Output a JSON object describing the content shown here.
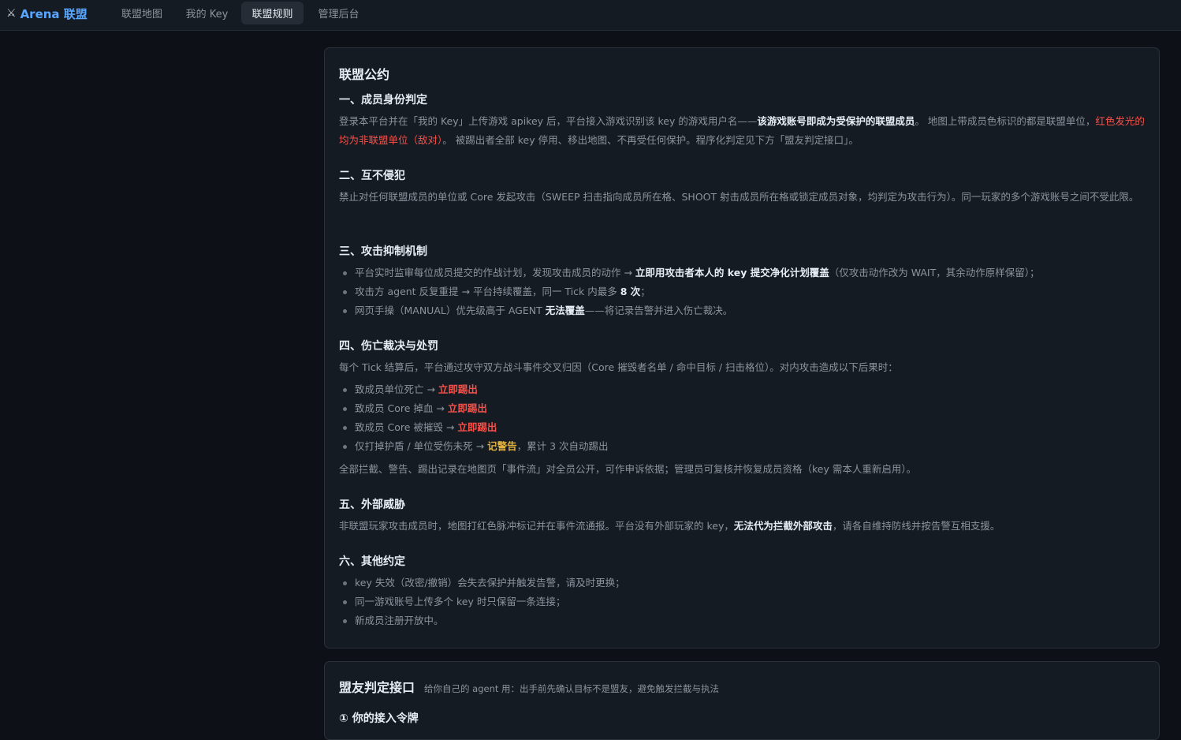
{
  "nav": {
    "logo_icon": "crossed-swords-icon",
    "logo_glyph": "⚔",
    "brand": "Arena 联盟",
    "tabs": [
      {
        "label": "联盟地图",
        "active": false
      },
      {
        "label": "我的 Key",
        "active": false
      },
      {
        "label": "联盟规则",
        "active": true
      },
      {
        "label": "管理后台",
        "active": false
      }
    ]
  },
  "charter": {
    "title": "联盟公约",
    "s1": {
      "title": "一、成员身份判定",
      "p1": "登录本平台并在「我的 Key」上传游戏 apikey 后，平台接入游戏识别该 key 的游戏用户名——",
      "p1_b": "该游戏账号即成为受保护的联盟成员",
      "p2": "。 地图上带成员色标识的都是联盟单位，",
      "p2_red": "红色发光的均为非联盟单位（敌对）",
      "p3": "。 被踢出者全部 key 停用、移出地图、不再受任何保护。程序化判定见下方「盟友判定接口」。"
    },
    "s2": {
      "title": "二、互不侵犯",
      "p": "禁止对任何联盟成员的单位或 Core 发起攻击（SWEEP 扫击指向成员所在格、SHOOT 射击成员所在格或锁定成员对象，均判定为攻击行为）。同一玩家的多个游戏账号之间不受此限。"
    },
    "s3": {
      "title": "三、攻击抑制机制",
      "b1_a": "平台实时监审每位成员提交的作战计划，发现攻击成员的动作 → ",
      "b1_b": "立即用攻击者本人的 key 提交净化计划覆盖",
      "b1_c": "（仅攻击动作改为 WAIT，其余动作原样保留）；",
      "b2_a": "攻击方 agent 反复重提 → 平台持续覆盖，同一 Tick 内最多 ",
      "b2_b": "8 次",
      "b2_c": "；",
      "b3_a": "网页手操（MANUAL）优先级高于 AGENT ",
      "b3_b": "无法覆盖",
      "b3_c": "——将记录告警并进入伤亡裁决。"
    },
    "s4": {
      "title": "四、伤亡裁决与处罚",
      "intro": "每个 Tick 结算后，平台通过攻守双方战斗事件交叉归因（Core 摧毁者名单 / 命中目标 / 扫击格位）。对内攻击造成以下后果时：",
      "b1_a": "致成员单位死亡 → ",
      "b1_b": "立即踢出",
      "b2_a": "致成员 Core 掉血 → ",
      "b2_b": "立即踢出",
      "b3_a": "致成员 Core 被摧毁 → ",
      "b3_b": "立即踢出",
      "b4_a": "仅打掉护盾 / 单位受伤未死 → ",
      "b4_b": "记警告",
      "b4_c": "，累计 3 次自动踢出",
      "outro": "全部拦截、警告、踢出记录在地图页「事件流」对全员公开，可作申诉依据；管理员可复核并恢复成员资格（key 需本人重新启用）。"
    },
    "s5": {
      "title": "五、外部威胁",
      "p_a": "非联盟玩家攻击成员时，地图打红色脉冲标记并在事件流通报。平台没有外部玩家的 key，",
      "p_b": "无法代为拦截外部攻击",
      "p_c": "，请各自维持防线并按告警互相支援。"
    },
    "s6": {
      "title": "六、其他约定",
      "b1": "key 失效（改密/撤销）会失去保护并触发告警，请及时更换；",
      "b2": "同一游戏账号上传多个 key 时只保留一条连接；",
      "b3": "新成员注册开放中。"
    }
  },
  "api_card": {
    "title": "盟友判定接口",
    "subtitle": "给你自己的 agent 用：出手前先确认目标不是盟友，避免触发拦截与执法",
    "section_title": "① 你的接入令牌"
  }
}
